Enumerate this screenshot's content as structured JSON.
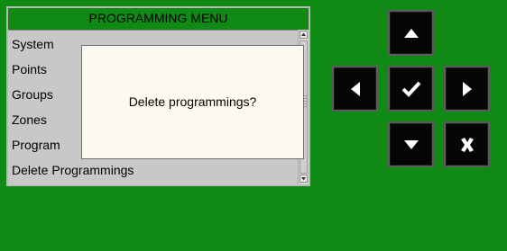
{
  "menu": {
    "title": "PROGRAMMING MENU",
    "items": [
      {
        "label": "System"
      },
      {
        "label": "Points"
      },
      {
        "label": "Groups"
      },
      {
        "label": "Zones"
      },
      {
        "label": "Program"
      },
      {
        "label": "Delete Programmings"
      }
    ]
  },
  "dialog": {
    "message": "Delete programmings?"
  },
  "nav": {
    "up": {
      "icon": "arrow-up-icon"
    },
    "left": {
      "icon": "arrow-left-icon"
    },
    "confirm": {
      "icon": "checkmark-icon"
    },
    "right": {
      "icon": "arrow-right-icon"
    },
    "down": {
      "icon": "arrow-down-icon"
    },
    "cancel": {
      "icon": "cancel-icon"
    }
  },
  "colors": {
    "background": "#0f8a14",
    "list_background": "#c8c8c8",
    "dialog_background": "#fdfaf0",
    "button_background": "#050505"
  }
}
